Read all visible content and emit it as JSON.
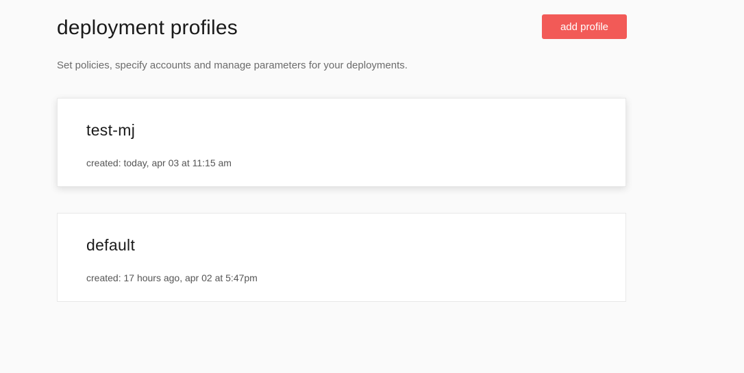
{
  "header": {
    "title": "deployment profiles",
    "add_button_label": "add profile",
    "subtitle": "Set policies, specify accounts and manage parameters for your deployments."
  },
  "profiles": [
    {
      "name": "test-mj",
      "created": "created: today, apr 03 at 11:15 am"
    },
    {
      "name": "default",
      "created": "created: 17 hours ago, apr 02 at 5:47pm"
    }
  ],
  "colors": {
    "accent": "#f25a57",
    "background": "#fafafa",
    "card": "#ffffff"
  }
}
